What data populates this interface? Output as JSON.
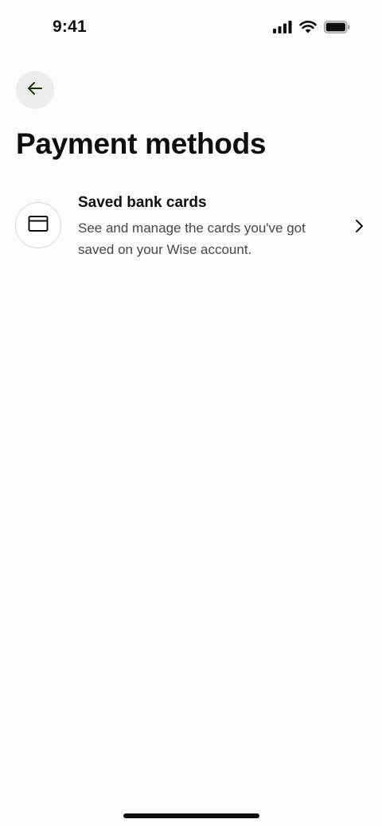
{
  "status_bar": {
    "time": "9:41",
    "icons": [
      "cellular-signal-icon",
      "wifi-icon",
      "battery-icon"
    ]
  },
  "header": {
    "back_icon": "arrow-left-icon",
    "title": "Payment methods"
  },
  "payment_methods": [
    {
      "icon": "card-icon",
      "title": "Saved bank cards",
      "description": "See and manage the cards you've got saved on your Wise account.",
      "trailing_icon": "chevron-right-icon"
    }
  ],
  "colors": {
    "background": "#fefcfc",
    "text_primary": "#0e0f0c",
    "text_secondary": "#454745",
    "back_button_bg": "#ececea",
    "avatar_border": "#d6d6d4"
  }
}
